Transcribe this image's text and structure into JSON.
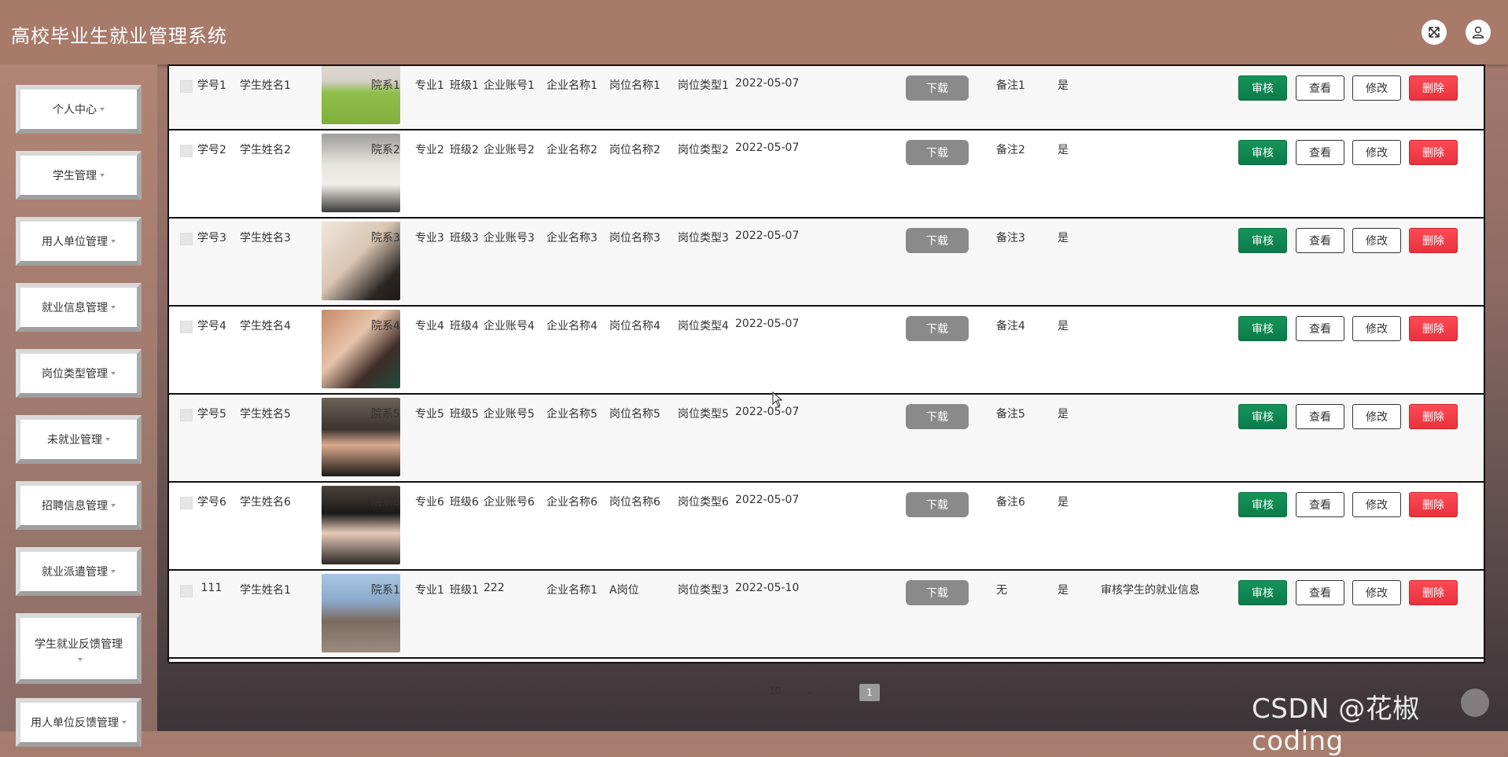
{
  "app": {
    "title": "高校毕业生就业管理系统"
  },
  "header": {
    "fullscreen_icon": "expand-icon",
    "user_icon": "user-icon"
  },
  "sidebar": {
    "items": [
      {
        "label": "个人中心"
      },
      {
        "label": "学生管理"
      },
      {
        "label": "用人单位管理"
      },
      {
        "label": "就业信息管理"
      },
      {
        "label": "岗位类型管理"
      },
      {
        "label": "未就业管理"
      },
      {
        "label": "招聘信息管理"
      },
      {
        "label": "就业派遣管理"
      },
      {
        "label": "学生就业反馈管理"
      },
      {
        "label": "用人单位反馈管理"
      }
    ]
  },
  "table": {
    "rows": [
      {
        "id": "学号1",
        "name": "学生姓名1",
        "dept": "院系1",
        "major": "专业1",
        "class": "班级1",
        "acct": "企业账号1",
        "company": "企业名称1",
        "post": "岗位名称1",
        "ptype": "岗位类型1",
        "date": "2022-05-07",
        "download": "下载",
        "note": "备注1",
        "flag": "是",
        "reply": "",
        "photo": "green"
      },
      {
        "id": "学号2",
        "name": "学生姓名2",
        "dept": "院系2",
        "major": "专业2",
        "class": "班级2",
        "acct": "企业账号2",
        "company": "企业名称2",
        "post": "岗位名称2",
        "ptype": "岗位类型2",
        "date": "2022-05-07",
        "download": "下载",
        "note": "备注2",
        "flag": "是",
        "reply": "",
        "photo": "grey"
      },
      {
        "id": "学号3",
        "name": "学生姓名3",
        "dept": "院系3",
        "major": "专业3",
        "class": "班级3",
        "acct": "企业账号3",
        "company": "企业名称3",
        "post": "岗位名称3",
        "ptype": "岗位类型3",
        "date": "2022-05-07",
        "download": "下载",
        "note": "备注3",
        "flag": "是",
        "reply": "",
        "photo": "beige"
      },
      {
        "id": "学号4",
        "name": "学生姓名4",
        "dept": "院系4",
        "major": "专业4",
        "class": "班级4",
        "acct": "企业账号4",
        "company": "企业名称4",
        "post": "岗位名称4",
        "ptype": "岗位类型4",
        "date": "2022-05-07",
        "download": "下载",
        "note": "备注4",
        "flag": "是",
        "reply": "",
        "photo": "warm"
      },
      {
        "id": "学号5",
        "name": "学生姓名5",
        "dept": "院系5",
        "major": "专业5",
        "class": "班级5",
        "acct": "企业账号5",
        "company": "企业名称5",
        "post": "岗位名称5",
        "ptype": "岗位类型5",
        "date": "2022-05-07",
        "download": "下载",
        "note": "备注5",
        "flag": "是",
        "reply": "",
        "photo": "dark"
      },
      {
        "id": "学号6",
        "name": "学生姓名6",
        "dept": "院系6",
        "major": "专业6",
        "class": "班级6",
        "acct": "企业账号6",
        "company": "企业名称6",
        "post": "岗位名称6",
        "ptype": "岗位类型6",
        "date": "2022-05-07",
        "download": "下载",
        "note": "备注6",
        "flag": "是",
        "reply": "",
        "photo": "dark2"
      },
      {
        "id": "111",
        "name": "学生姓名1",
        "dept": "院系1",
        "major": "专业1",
        "class": "班级1",
        "acct": "222",
        "company": "企业名称1",
        "post": "A岗位",
        "ptype": "岗位类型3",
        "date": "2022-05-10",
        "download": "下载",
        "note": "无",
        "flag": "是",
        "reply": "审核学生的就业信息",
        "photo": "blue"
      }
    ],
    "actions": {
      "review": "审核",
      "view": "查看",
      "edit": "修改",
      "delete": "删除"
    }
  },
  "pagination": {
    "page_size": "10",
    "current_page": "1"
  },
  "watermark": "CSDN @花椒coding",
  "colors": {
    "review": "#0c7b4a",
    "delete": "#e8323d",
    "download": "#8a8a8a",
    "header": "#a87a6a"
  }
}
